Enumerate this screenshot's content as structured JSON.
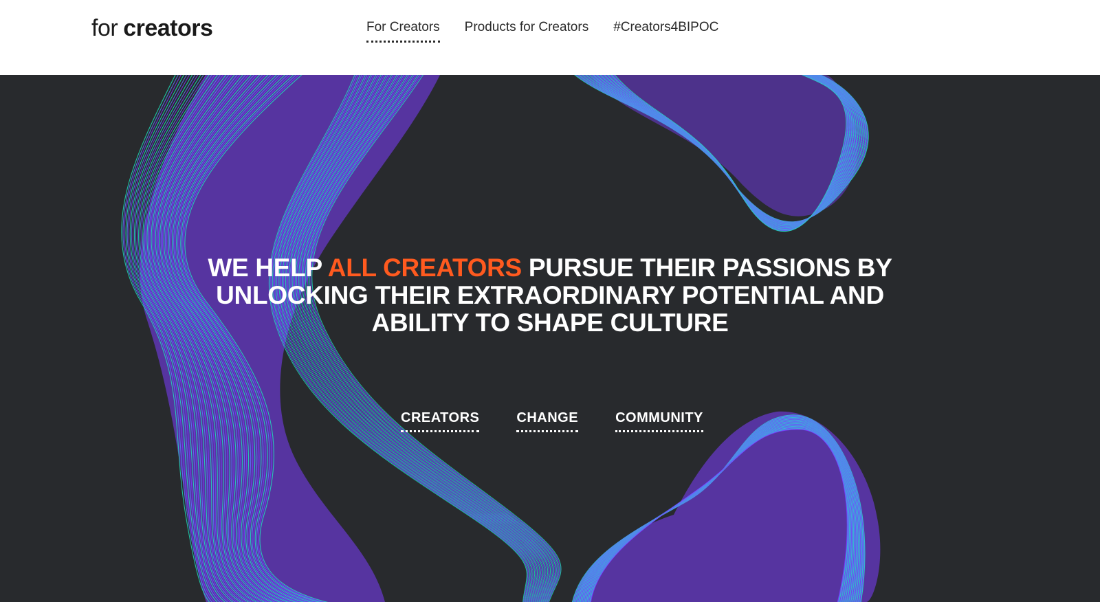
{
  "header": {
    "logo": {
      "for": "for",
      "creators": "creators"
    },
    "nav": [
      {
        "label": "For Creators",
        "active": true
      },
      {
        "label": "Products for Creators",
        "active": false
      },
      {
        "label": "#Creators4BIPOC",
        "active": false
      }
    ]
  },
  "hero": {
    "headline": {
      "part1": "WE HELP ",
      "accent": "ALL CREATORS",
      "part2": " PURSUE THEIR PASSIONS BY UNLOCKING THEIR EXTRAORDINARY POTENTIAL AND ABILITY TO SHAPE CULTURE"
    },
    "links": [
      {
        "label": "CREATORS"
      },
      {
        "label": "CHANGE"
      },
      {
        "label": "COMMUNITY"
      }
    ]
  },
  "colors": {
    "background": "#282a2d",
    "accent": "#ff5a1f",
    "purple": "#7b3cff",
    "teal": "#1de9c0",
    "header_bg": "#ffffff"
  }
}
